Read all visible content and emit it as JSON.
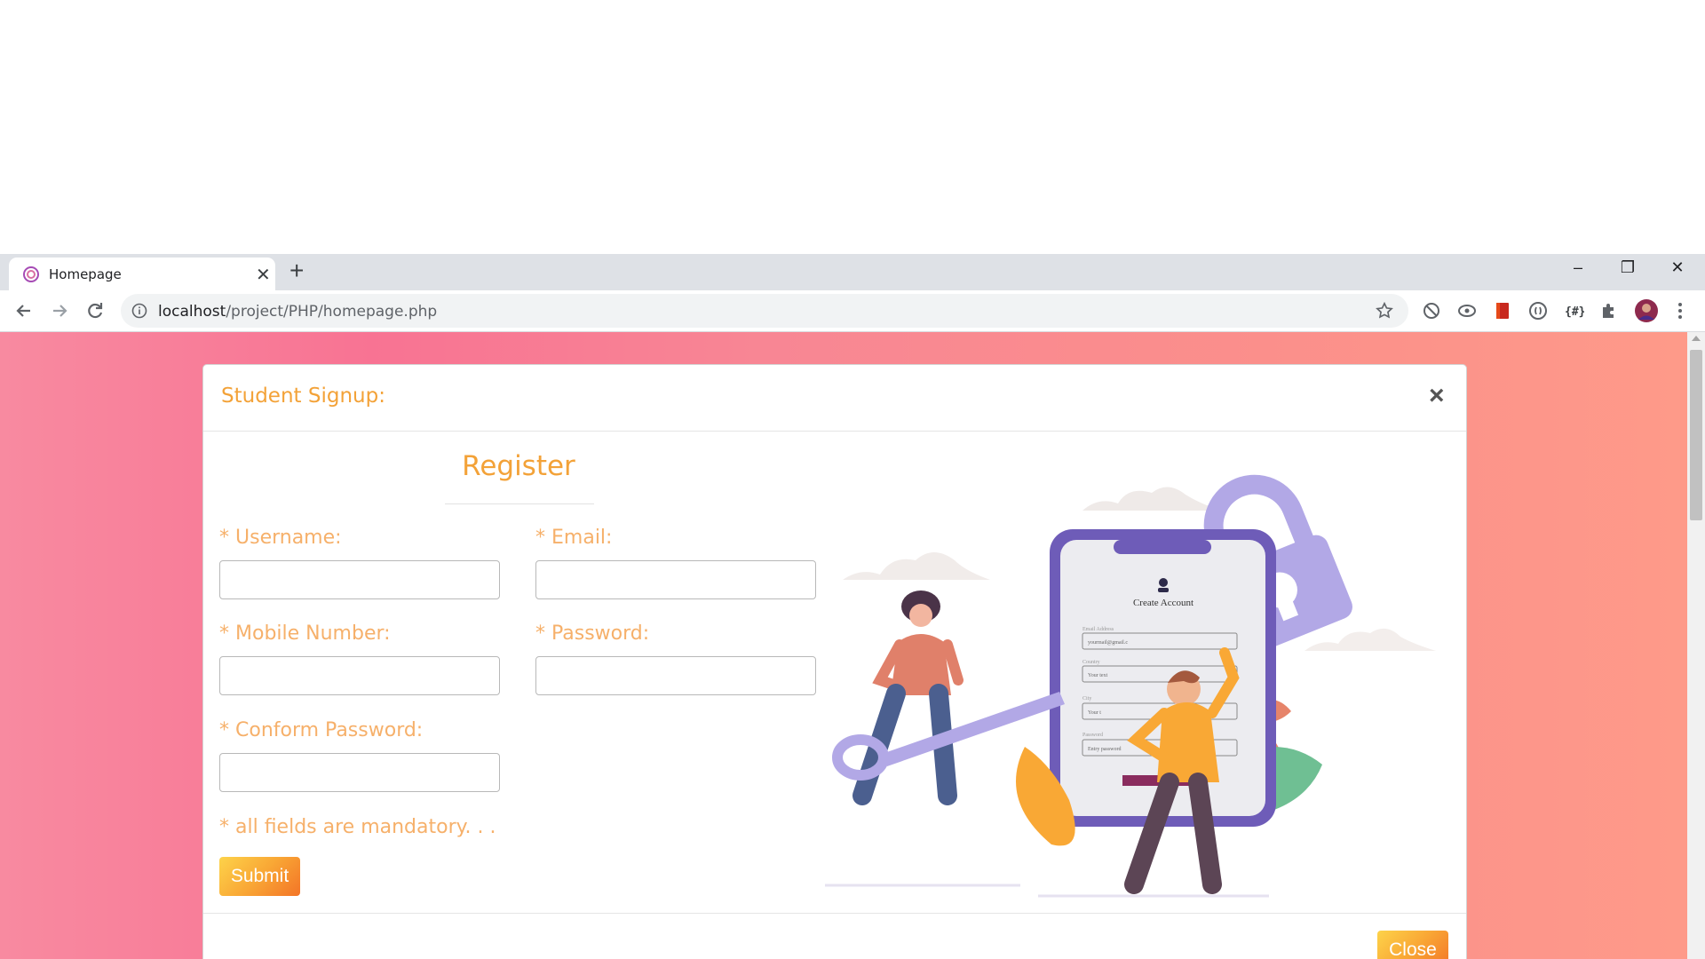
{
  "browser": {
    "tab_title": "Homepage",
    "url_host": "localhost",
    "url_path": "/project/PHP/homepage.php"
  },
  "modal": {
    "title": "Student Signup:",
    "close_symbol": "×",
    "heading": "Register",
    "fields": [
      {
        "label": "Username:",
        "value": "",
        "placeholder": ""
      },
      {
        "label": "Email:",
        "value": "",
        "placeholder": ""
      },
      {
        "label": "Mobile Number:",
        "value": "",
        "placeholder": ""
      },
      {
        "label": "Password:",
        "value": "",
        "placeholder": ""
      },
      {
        "label": "Conform Password:",
        "value": "",
        "placeholder": ""
      }
    ],
    "required_marker": "*",
    "mandatory_note": "* all fields are mandatory. . .",
    "submit_label": "Submit",
    "close_label": "Close"
  },
  "illustration": {
    "phone_heading": "Create Account",
    "form_rows": [
      {
        "label": "Email Address",
        "value": "yourmail@gmail.c"
      },
      {
        "label": "Country",
        "value": "Your text"
      },
      {
        "label": "City",
        "value": "Your t"
      },
      {
        "label": "Password",
        "value": "Entry password"
      }
    ]
  },
  "colors": {
    "accent": "#f3a238",
    "label": "#f6b06a",
    "gradient_start": "#fdd34a",
    "gradient_end": "#f37427"
  }
}
